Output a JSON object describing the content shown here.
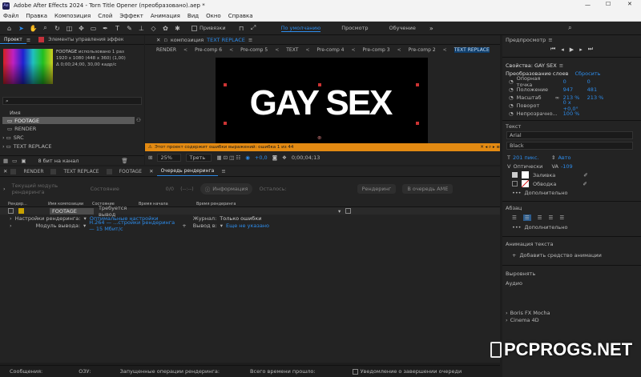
{
  "window": {
    "title": "Adobe After Effects 2024 - Torn Title Opener (преобразовано).aep *",
    "app_badge": "Ae"
  },
  "menu": [
    "Файл",
    "Правка",
    "Композиция",
    "Слой",
    "Эффект",
    "Анимация",
    "Вид",
    "Окно",
    "Справка"
  ],
  "toolbar": {
    "snap_label": "Привязки",
    "workspaces": [
      "По умолчанию",
      "Просмотр",
      "Обучение"
    ]
  },
  "project": {
    "tab_project": "Проект",
    "tab_effects": "Элементы управления эффек",
    "item_name": "FOOTAGE",
    "item_usage": "использовано 1 раз",
    "item_dims": "1920 x 1080 (448 x 360) (1,00)",
    "item_duration": "Δ 0;00;24;00, 30,00 кадр/с",
    "search_placeholder": "",
    "col_name": "Имя",
    "items": [
      "FOOTAGE",
      "RENDER",
      "SRC",
      "TEXT REPLACE"
    ],
    "bpc": "8 бит на канал"
  },
  "composition": {
    "tab_prefix": "композиция",
    "tab_name": "TEXT REPLACE",
    "subtabs": [
      "RENDER",
      "Pre-comp 6",
      "Pre-comp 5",
      "TEXT",
      "Pre-comp 4",
      "Pre-comp 3",
      "Pre-comp 2",
      "TEXT REPLACE"
    ],
    "canvas_text": "GAY SEX",
    "error_text": "Этот проект содержит ошибки выражений: ошибка 1 из 44",
    "zoom": "25%",
    "resolution": "Треть",
    "exposure": "+0,0",
    "timecode": "0;00;04;13"
  },
  "timeline": {
    "tabs": [
      "RENDER",
      "TEXT REPLACE",
      "FOOTAGE",
      "Очередь рендеринга"
    ],
    "current_module": "Текущий модуль рендеринга",
    "status_placeholder": "Состояние",
    "queue_count": "0/0",
    "time_est": "(--:--)",
    "info_btn": "Информация",
    "remaining": "Осталось:",
    "render_btn": "Рендеринг",
    "ame_btn": "В очередь AME",
    "columns": [
      "Рендер...",
      "",
      "",
      "Имя композиции",
      "Состояние",
      "Время начала",
      "Время рендеринга",
      ""
    ],
    "row_name": "FOOTAGE",
    "row_status": "Требуется вывод",
    "settings_label": "Настройки рендеринга:",
    "settings_value": "Оптимальные настройки",
    "log_label": "Журнал:",
    "log_value": "Только ошибки",
    "output_module_label": "Модуль вывода:",
    "output_module_value": "H.264 — ...стройки рендеринга — 15 Мбит/с",
    "output_to_label": "Вывод в:",
    "output_to_value": "Еще не указано"
  },
  "statusbar": {
    "messages": "Сообщения:",
    "ram": "ОЗУ:",
    "running": "Запущенные операции рендеринга:",
    "total_time": "Всего времени прошло:",
    "notify": "Уведомление о завершении очереди"
  },
  "right": {
    "preview": "Предпросмотр",
    "props_title": "Свойства: GAY SEX",
    "transform": "Преобразование слоев",
    "reset": "Сбросить",
    "props": [
      {
        "name": "Опорная точка",
        "v1": "0",
        "v2": "0"
      },
      {
        "name": "Положение",
        "v1": "947",
        "v2": "481"
      },
      {
        "name": "Масштаб",
        "v1": "213 %",
        "v2": "213 %"
      },
      {
        "name": "Поворот",
        "v1": "0 x +0,0°",
        "v2": ""
      },
      {
        "name": "Непрозрачно...",
        "v1": "100 %",
        "v2": ""
      }
    ],
    "text_section": "Текст",
    "font": "Arial",
    "font_style": "Black",
    "font_size": "201 пикс.",
    "leading": "Авто",
    "kerning": "Оптически",
    "tracking": "-109",
    "fill": "Заливка",
    "stroke": "Обводка",
    "more": "Дополнительно",
    "paragraph": "Абзац",
    "more2": "Дополнительно",
    "anim_text": "Анимация текста",
    "add_anim": "Добавить средство анимации",
    "align": "Выровнять",
    "audio": "Аудио",
    "plugins": [
      "Boris FX Mocha",
      "Cinema 4D"
    ]
  },
  "watermark": "PCPROGS.NET"
}
